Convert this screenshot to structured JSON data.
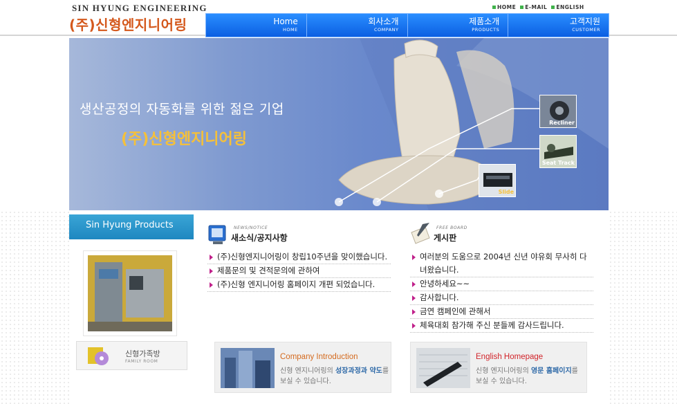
{
  "header": {
    "brand_en": "SIN HYUNG ENGINEERING",
    "brand_ko": "(주)신형엔지니어링",
    "util_links": [
      "HOME",
      "E-MAIL",
      "ENGLISH"
    ],
    "nav": [
      {
        "ko": "Home",
        "en": "HOME"
      },
      {
        "ko": "회사소개",
        "en": "COMPANY"
      },
      {
        "ko": "제품소개",
        "en": "PRODUCTS"
      },
      {
        "ko": "고객지원",
        "en": "CUSTOMER"
      }
    ]
  },
  "hero": {
    "slogan": "생산공정의 자동화를 위한 젊은 기업",
    "brand": "(주)신형엔지니어링",
    "thumbs": [
      "Recliner",
      "Seat Track",
      "Slide"
    ]
  },
  "left": {
    "products_title": "Sin Hyung Products",
    "family_ko": "신형가족방",
    "family_en": "FAMILY ROOM"
  },
  "news": {
    "sub": "NEWS/NOTICE",
    "title": "새소식/공지사항",
    "items": [
      "(주)신형엔지니어링이 창립10주년을 맞이했습니다.",
      "제품문의 및 견적문의에 관하여",
      "(주)신형 엔지니어링 홈페이지 개편 되었습니다."
    ]
  },
  "board": {
    "sub": "FREE BOARD",
    "title": "게시판",
    "items": [
      "여러분의 도움으로 2004년 신년 야유회 무사히 다녀왔습니다.",
      "안녕하세요~~",
      "감사합니다.",
      "금연 캠페인에 관해서",
      "체육대회 참가해 주신 분들께 감사드립니다."
    ]
  },
  "promos": {
    "company": {
      "title": "Company Introduction",
      "desc_a": "신형 엔지니어링의 ",
      "desc_b": "성장과정과 약도",
      "desc_c": "를 보실 수 있습니다."
    },
    "english": {
      "title": "English Homepage",
      "desc_a": "신형 엔지니어링의 ",
      "desc_b": "영문 홈페이지",
      "desc_c": "를 보실 수 있습니다."
    }
  },
  "colors": {
    "nav_blue": "#1a74f0",
    "brand_orange": "#d4581c",
    "bullet": "#c0208a",
    "products_blue": "#2b97cc"
  }
}
